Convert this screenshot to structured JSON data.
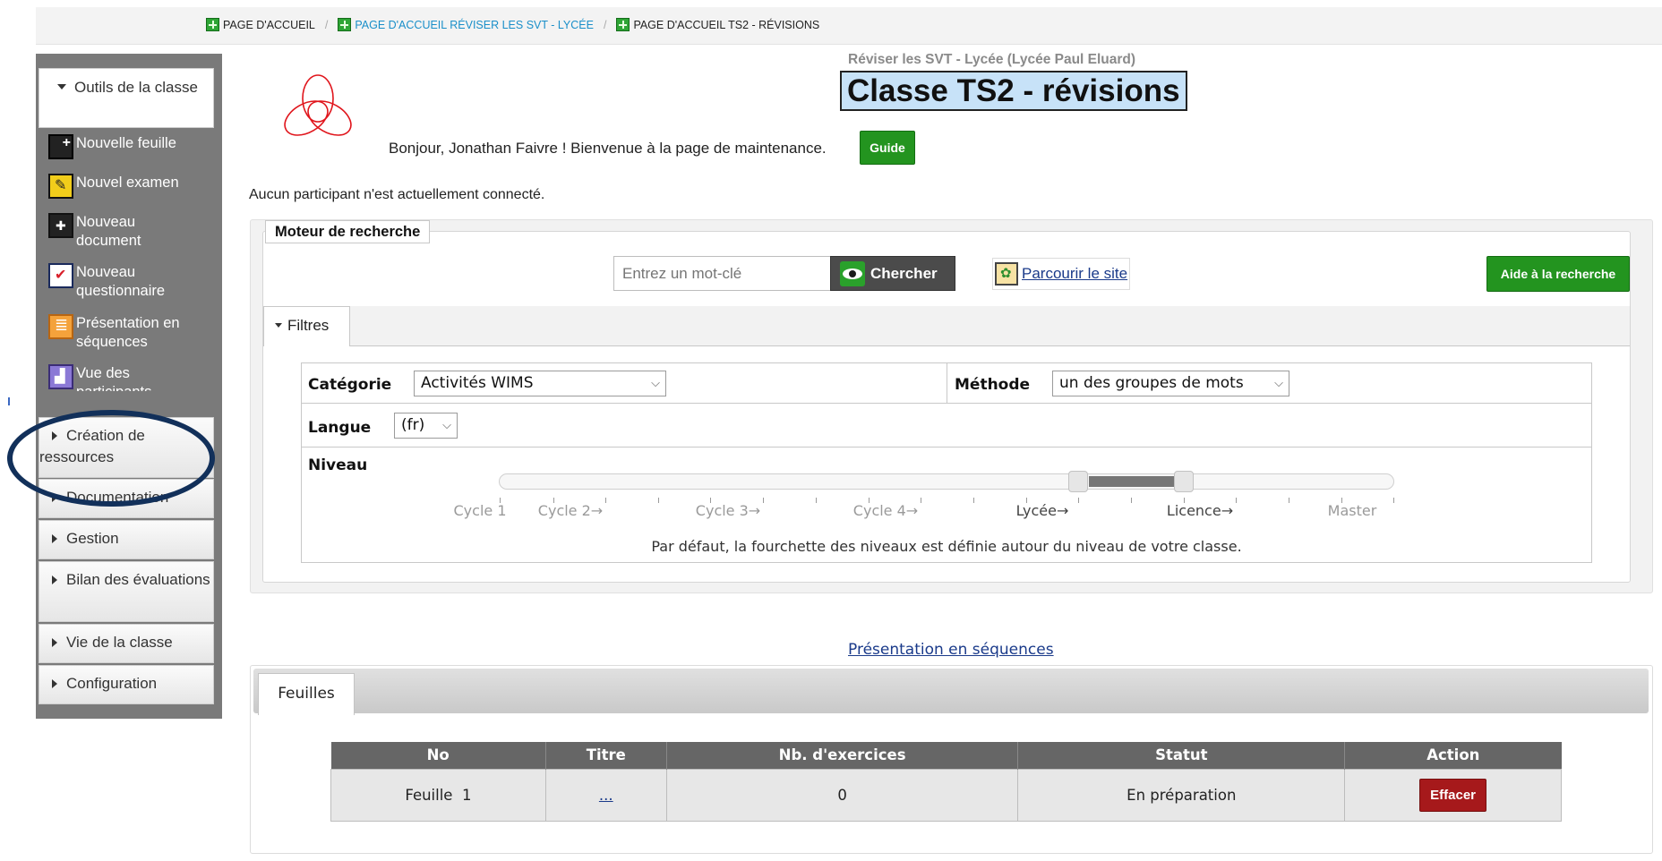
{
  "breadcrumb": {
    "items": [
      {
        "label": "PAGE D'ACCUEIL"
      },
      {
        "label": "PAGE D'ACCUEIL RÉVISER LES SVT - LYCÉE"
      },
      {
        "label": "PAGE D'ACCUEIL TS2 - RÉVISIONS"
      }
    ],
    "separator": "/"
  },
  "sidebar": {
    "header": "Outils de la classe",
    "tools": [
      {
        "label": "Nouvelle feuille",
        "icon": "new-sheet-icon"
      },
      {
        "label": "Nouvel examen",
        "icon": "new-exam-icon"
      },
      {
        "label": "Nouveau document",
        "icon": "new-document-icon"
      },
      {
        "label": "Nouveau questionnaire",
        "icon": "new-questionnaire-icon"
      },
      {
        "label": "Présentation en séquences",
        "icon": "sequences-icon"
      },
      {
        "label": "Vue des participants",
        "icon": "participants-icon"
      }
    ],
    "categories": [
      {
        "label": "Création de ressources"
      },
      {
        "label": "Documentation"
      },
      {
        "label": "Gestion"
      },
      {
        "label": "Bilan des évaluations"
      },
      {
        "label": "Vie de la classe"
      },
      {
        "label": "Configuration"
      }
    ]
  },
  "header": {
    "subtitle": "Réviser les SVT - Lycée (Lycée Paul Eluard)",
    "title": "Classe TS2 - révisions",
    "greeting": "Bonjour, Jonathan Faivre ! Bienvenue à la page de maintenance.",
    "guide_label": "Guide",
    "connected_text": "Aucun participant n'est actuellement connecté."
  },
  "search": {
    "legend": "Moteur de recherche",
    "placeholder": "Entrez un mot-clé",
    "button_label": "Chercher",
    "browse_label": "Parcourir le site",
    "help_label": "Aide à la recherche"
  },
  "filters": {
    "tab_label": "Filtres",
    "category_label": "Catégorie",
    "category_value": "Activités WIMS",
    "method_label": "Méthode",
    "method_value": "un des groupes de mots",
    "language_label": "Langue",
    "language_value": "(fr)",
    "level_label": "Niveau",
    "levels": [
      "Cycle 1",
      "Cycle 2→",
      "Cycle 3→",
      "Cycle 4→",
      "Lycée→",
      "Licence→",
      "Master"
    ],
    "range_selected": [
      "Lycée",
      "Licence"
    ],
    "hint": "Par défaut, la fourchette des niveaux est définie autour du niveau de votre classe."
  },
  "sequences_link": "Présentation en séquences",
  "sheets": {
    "tab_label": "Feuilles",
    "columns": [
      "No",
      "Titre",
      "Nb. d'exercices",
      "Statut",
      "Action"
    ],
    "rows": [
      {
        "no": "Feuille  1",
        "title": "...",
        "count": "0",
        "status": "En préparation",
        "action": "Effacer"
      }
    ]
  },
  "colors": {
    "accent_green": "#23941f",
    "danger_red": "#a6191b",
    "title_highlight": "#c7e2f8",
    "link_blue": "#1a3a8a",
    "annotation_ring": "#12305a"
  }
}
